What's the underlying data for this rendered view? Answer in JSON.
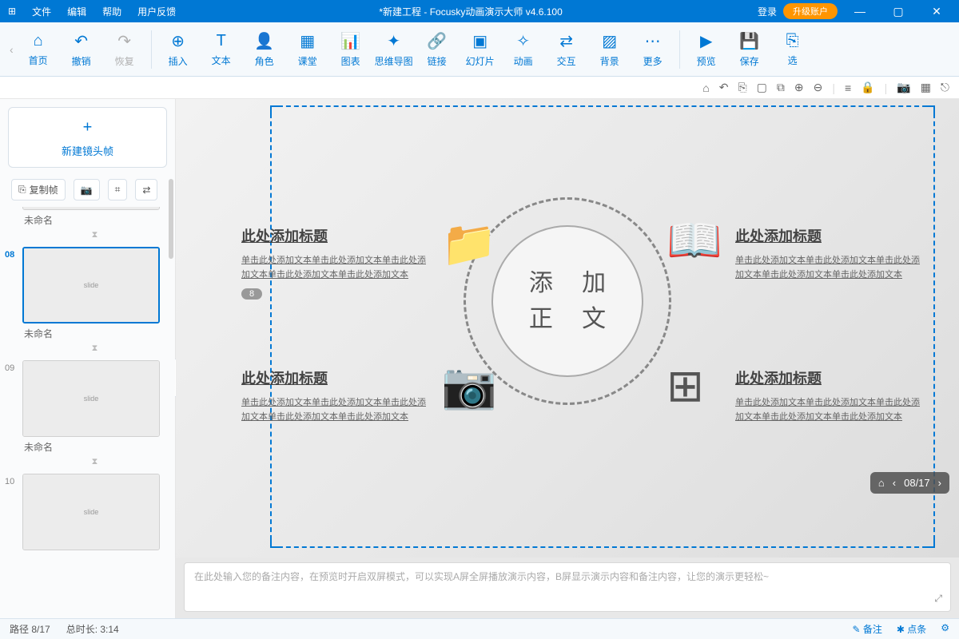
{
  "titlebar": {
    "menus": [
      "文件",
      "编辑",
      "帮助",
      "用户反馈"
    ],
    "title": "*新建工程 - Focusky动画演示大师  v4.6.100",
    "login": "登录",
    "upgrade": "升级账户"
  },
  "toolbar": {
    "items": [
      {
        "ico": "⌂",
        "label": "首页"
      },
      {
        "ico": "↶",
        "label": "撤销"
      },
      {
        "ico": "↷",
        "label": "恢复",
        "disabled": true
      }
    ],
    "items2": [
      {
        "ico": "⊕",
        "label": "插入"
      },
      {
        "ico": "T",
        "label": "文本"
      },
      {
        "ico": "👤",
        "label": "角色"
      },
      {
        "ico": "▦",
        "label": "课堂"
      },
      {
        "ico": "📊",
        "label": "图表"
      },
      {
        "ico": "✦",
        "label": "思维导图"
      },
      {
        "ico": "🔗",
        "label": "链接"
      },
      {
        "ico": "▣",
        "label": "幻灯片"
      },
      {
        "ico": "✧",
        "label": "动画"
      },
      {
        "ico": "⇄",
        "label": "交互"
      },
      {
        "ico": "▨",
        "label": "背景"
      },
      {
        "ico": "⋯",
        "label": "更多"
      }
    ],
    "items3": [
      {
        "ico": "▶",
        "label": "预览"
      },
      {
        "ico": "💾",
        "label": "保存"
      },
      {
        "ico": "⎘",
        "label": "选"
      }
    ]
  },
  "sidebar": {
    "newframe": "新建镜头帧",
    "copyframe": "复制帧",
    "thumbs": [
      {
        "num": "",
        "label": "未命名",
        "partial": true
      },
      {
        "num": "08",
        "label": "未命名",
        "active": true
      },
      {
        "num": "09",
        "label": "未命名"
      },
      {
        "num": "10",
        "label": ""
      }
    ]
  },
  "canvas": {
    "center1": "添 加",
    "center2": "正 文",
    "blockTitle": "此处添加标题",
    "blockBody": "单击此处添加文本单击此处添加文本单击此处添加文本单击此处添加文本单击此处添加文本",
    "badge": "8",
    "slidenav": "08/17"
  },
  "notes": {
    "placeholder": "在此处输入您的备注内容，在预览时开启双屏模式，可以实现A屏全屏播放演示内容，B屏显示演示内容和备注内容，让您的演示更轻松~"
  },
  "status": {
    "path": "路径 8/17",
    "duration": "总时长: 3:14",
    "remark": "✎ 备注",
    "click": "✱ 点条",
    "settings": "⚙"
  }
}
